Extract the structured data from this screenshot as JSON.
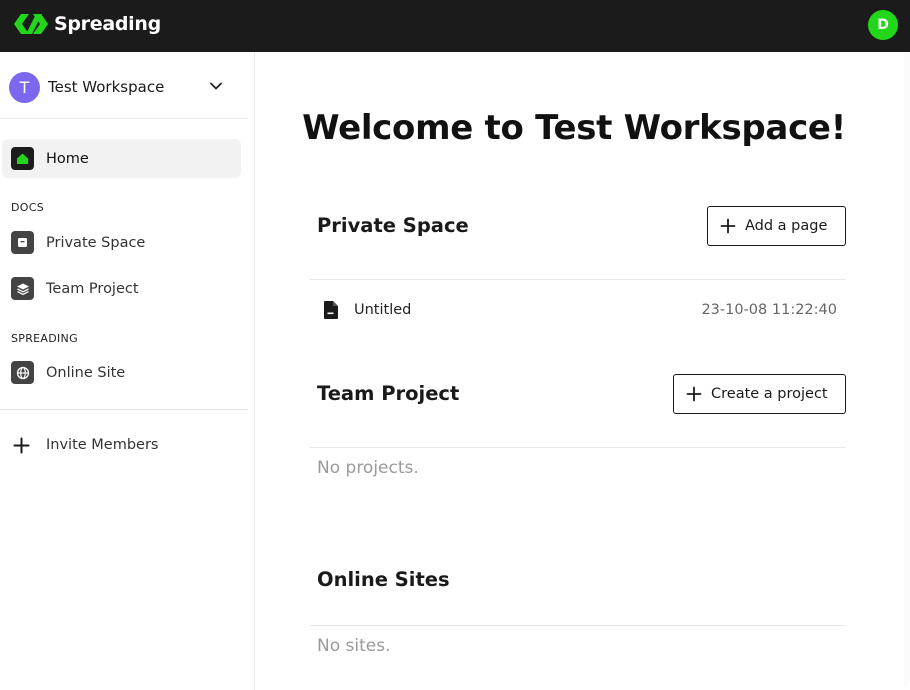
{
  "header": {
    "brand": "Spreading",
    "user_initial": "D",
    "colors": {
      "bar": "#1b1b1b",
      "brand_green": "#22d61a"
    }
  },
  "sidebar": {
    "workspace": {
      "initial": "T",
      "name": "Test Workspace",
      "avatar_color": "#7b68ee"
    },
    "home_label": "Home",
    "docs_section": "DOCS",
    "docs_items": [
      {
        "label": "Private Space",
        "icon": "box-icon"
      },
      {
        "label": "Team Project",
        "icon": "layers-icon"
      }
    ],
    "spreading_section": "SPREADING",
    "spreading_items": [
      {
        "label": "Online Site",
        "icon": "globe-icon"
      }
    ],
    "invite_label": "Invite Members"
  },
  "main": {
    "welcome": "Welcome to Test Workspace!",
    "private_space": {
      "title": "Private Space",
      "button": "Add a page",
      "pages": [
        {
          "name": "Untitled",
          "time": "23-10-08 11:22:40"
        }
      ]
    },
    "team_project": {
      "title": "Team Project",
      "button": "Create a project",
      "empty": "No projects."
    },
    "online_sites": {
      "title": "Online Sites",
      "empty": "No sites."
    }
  }
}
